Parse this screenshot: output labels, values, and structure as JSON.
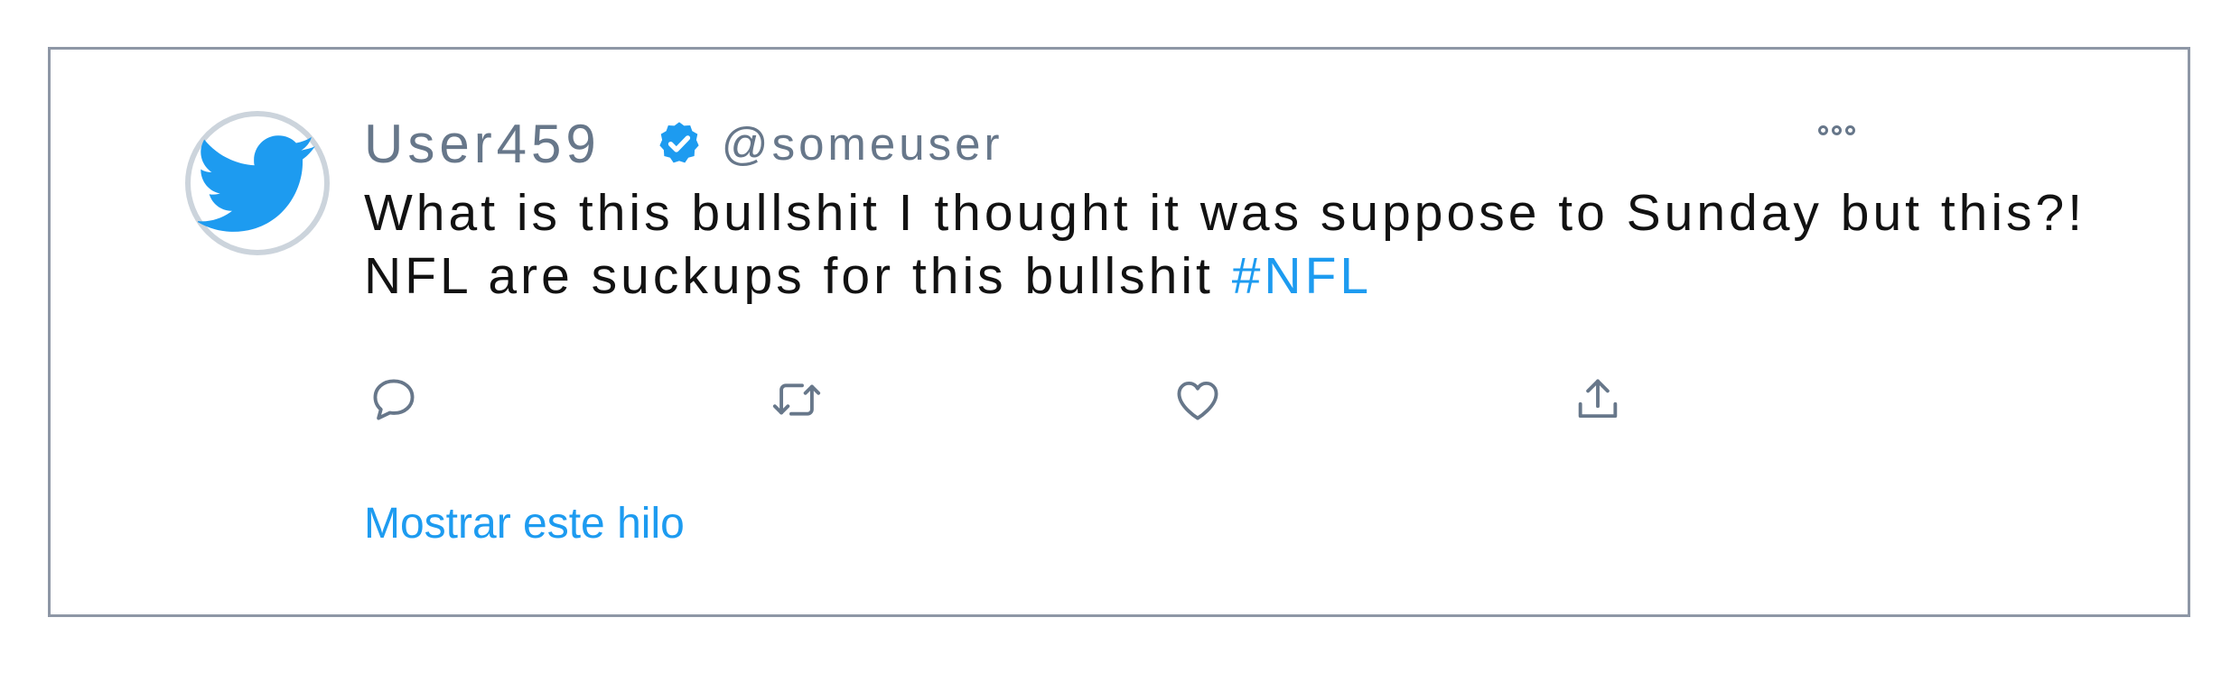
{
  "tweet": {
    "display_name": "User459",
    "handle": "@someuser",
    "verified_icon": "verified-badge-icon",
    "avatar_icon": "twitter-bird-icon",
    "more_icon": "more-options-icon",
    "text": "What is this bullshit I thought it was suppose to Sunday but this?! NFL are suckups for this bullshit ",
    "hashtag": "#NFL",
    "actions": [
      {
        "name": "reply",
        "icon": "reply-icon"
      },
      {
        "name": "retweet",
        "icon": "retweet-icon"
      },
      {
        "name": "like",
        "icon": "like-icon"
      },
      {
        "name": "share",
        "icon": "share-icon"
      }
    ],
    "show_thread_label": "Mostrar este hilo"
  },
  "colors": {
    "accent": "#1d9bf0",
    "secondary_text": "#67778a",
    "primary_text": "#121212",
    "border": "#8e97a6"
  }
}
